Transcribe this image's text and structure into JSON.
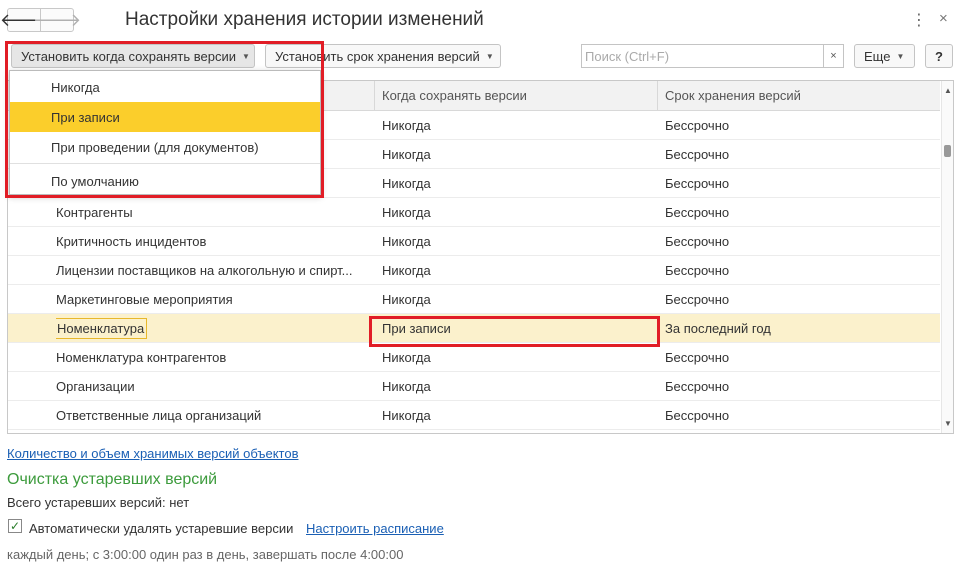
{
  "window": {
    "title": "Настройки хранения истории изменений",
    "back_icon": "🡐",
    "forward_icon": "🡒",
    "more_icon": "⋮",
    "close_icon": "×"
  },
  "toolbar": {
    "set_when_label": "Установить когда сохранять версии",
    "set_term_label": "Установить срок хранения версий",
    "search_placeholder": "Поиск (Ctrl+F)",
    "search_clear": "×",
    "more_label": "Еще",
    "help_label": "?",
    "caret": "▼"
  },
  "dropdown": {
    "items": [
      {
        "label": "Никогда"
      },
      {
        "label": "При записи"
      },
      {
        "label": "При проведении (для документов)"
      },
      {
        "label": "По умолчанию"
      }
    ],
    "active_index": 1
  },
  "table": {
    "columns": [
      "",
      "Когда сохранять версии",
      "Срок хранения версий"
    ],
    "rows": [
      {
        "name": "",
        "when": "Никогда",
        "term": "Бессрочно"
      },
      {
        "name": "",
        "when": "Никогда",
        "term": "Бессрочно"
      },
      {
        "name": "",
        "when": "Никогда",
        "term": "Бессрочно"
      },
      {
        "name": "Контрагенты",
        "when": "Никогда",
        "term": "Бессрочно"
      },
      {
        "name": "Критичность инцидентов",
        "when": "Никогда",
        "term": "Бессрочно"
      },
      {
        "name": "Лицензии поставщиков на алкогольную и спирт...",
        "when": "Никогда",
        "term": "Бессрочно"
      },
      {
        "name": "Маркетинговые мероприятия",
        "when": "Никогда",
        "term": "Бессрочно"
      },
      {
        "name": "Номенклатура",
        "when": "При записи",
        "term": "За последний год"
      },
      {
        "name": "Номенклатура контрагентов",
        "when": "Никогда",
        "term": "Бессрочно"
      },
      {
        "name": "Организации",
        "when": "Никогда",
        "term": "Бессрочно"
      },
      {
        "name": "Ответственные лица организаций",
        "when": "Никогда",
        "term": "Бессрочно"
      }
    ],
    "selected_row": 7
  },
  "footer": {
    "stats_link": "Количество и объем хранимых версий объектов",
    "cleanup_title": "Очистка устаревших версий",
    "obsolete_count": "Всего устаревших версий: нет",
    "auto_delete_label": "Автоматически удалять устаревшие версии",
    "auto_delete_checked": true,
    "check_mark": "✓",
    "schedule_link": "Настроить расписание",
    "schedule_text": "каждый день; с 3:00:00 один раз в день, завершать после 4:00:00"
  },
  "colors": {
    "accent_yellow": "#fbce2b",
    "selected_row": "#fbf1cc",
    "annotation_red": "#e11d26",
    "link_blue": "#1a5fb4",
    "section_green": "#3c9b3c"
  }
}
